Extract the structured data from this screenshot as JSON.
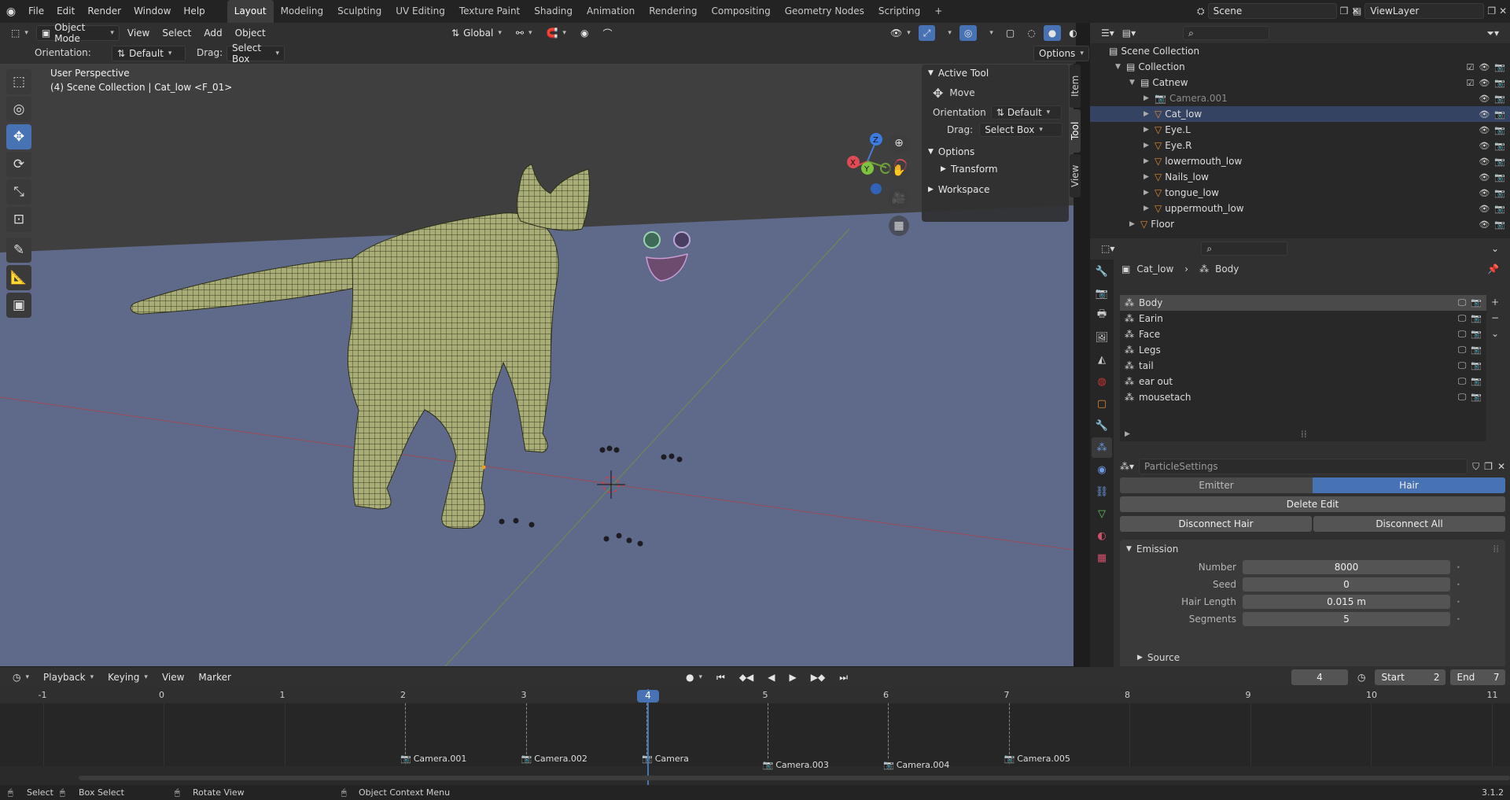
{
  "menubar": {
    "items": [
      "File",
      "Edit",
      "Render",
      "Window",
      "Help"
    ],
    "workspaces": [
      "Layout",
      "Modeling",
      "Sculpting",
      "UV Editing",
      "Texture Paint",
      "Shading",
      "Animation",
      "Rendering",
      "Compositing",
      "Geometry Nodes",
      "Scripting"
    ],
    "active_workspace": "Layout",
    "scene_name": "Scene",
    "view_layer": "ViewLayer"
  },
  "viewport_header": {
    "mode": "Object Mode",
    "menus": [
      "View",
      "Select",
      "Add",
      "Object"
    ],
    "transform_orientation": "Global",
    "options_label": "Options"
  },
  "tool_settings": {
    "orientation_label": "Orientation:",
    "orientation_value": "Default",
    "drag_label": "Drag:",
    "drag_value": "Select Box"
  },
  "viewport": {
    "perspective_label": "User Perspective",
    "context_label": "(4) Scene Collection | Cat_low <F_01>",
    "axes": {
      "x": "X",
      "y": "Y",
      "z": "Z"
    }
  },
  "npanel": {
    "section_active_tool": "Active Tool",
    "tool_name": "Move",
    "orientation_label": "Orientation",
    "orientation_value": "Default",
    "drag_label": "Drag:",
    "drag_value": "Select Box",
    "section_options": "Options",
    "sub_transform": "Transform",
    "section_workspace": "Workspace",
    "tabs": [
      "Item",
      "Tool",
      "View"
    ]
  },
  "outliner": {
    "root": "Scene Collection",
    "rows": [
      {
        "name": "Collection",
        "indent": 1,
        "type": "collection"
      },
      {
        "name": "Catnew",
        "indent": 2,
        "type": "collection"
      },
      {
        "name": "Camera.001",
        "indent": 3,
        "type": "camera",
        "dim": true
      },
      {
        "name": "Cat_low",
        "indent": 3,
        "type": "mesh",
        "selected": true
      },
      {
        "name": "Eye.L",
        "indent": 3,
        "type": "mesh"
      },
      {
        "name": "Eye.R",
        "indent": 3,
        "type": "mesh"
      },
      {
        "name": "lowermouth_low",
        "indent": 3,
        "type": "mesh"
      },
      {
        "name": "Nails_low",
        "indent": 3,
        "type": "mesh"
      },
      {
        "name": "tongue_low",
        "indent": 3,
        "type": "mesh"
      },
      {
        "name": "uppermouth_low",
        "indent": 3,
        "type": "mesh"
      },
      {
        "name": "Floor",
        "indent": 2,
        "type": "mesh"
      }
    ]
  },
  "properties": {
    "breadcrumb_object": "Cat_low",
    "breadcrumb_system": "Body",
    "particle_systems": [
      "Body",
      "Earin",
      "Face",
      "Legs",
      "tail",
      "ear out",
      "mousetach"
    ],
    "settings_name": "ParticleSettings",
    "type_tabs": [
      "Emitter",
      "Hair"
    ],
    "active_type": "Hair",
    "delete_edit": "Delete Edit",
    "disconnect_hair": "Disconnect Hair",
    "disconnect_all": "Disconnect All",
    "emission_header": "Emission",
    "fields": [
      {
        "label": "Number",
        "value": "8000"
      },
      {
        "label": "Seed",
        "value": "0"
      },
      {
        "label": "Hair Length",
        "value": "0.015 m"
      },
      {
        "label": "Segments",
        "value": "5"
      }
    ],
    "source_header": "Source"
  },
  "timeline": {
    "menus": [
      "Playback",
      "Keying",
      "View",
      "Marker"
    ],
    "current_frame": "4",
    "start_label": "Start",
    "start_value": "2",
    "end_label": "End",
    "end_value": "7",
    "ruler": [
      "-1",
      "0",
      "1",
      "2",
      "3",
      "4",
      "5",
      "6",
      "7",
      "8",
      "9",
      "10",
      "11"
    ],
    "markers": [
      "Camera.001",
      "Camera.002",
      "Camera",
      "Camera.003",
      "Camera.004",
      "Camera.005"
    ]
  },
  "statusbar": {
    "select": "Select",
    "box_select": "Box Select",
    "rotate_view": "Rotate View",
    "context_menu": "Object Context Menu",
    "version": "3.1.2"
  },
  "colors": {
    "accent": "#4772b3",
    "selection": "#354363",
    "floor": "#5f6a8a",
    "mesh": "#a8ad78"
  }
}
